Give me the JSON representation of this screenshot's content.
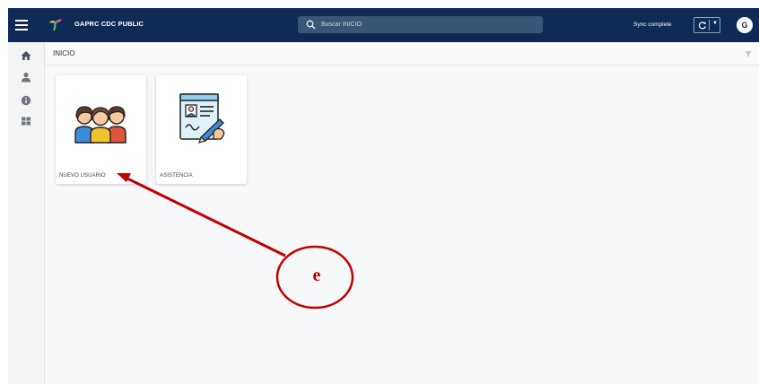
{
  "topbar": {
    "app_title": "GAPRC CDC PUBLIC",
    "search_placeholder": "Buscar INICIO",
    "sync_status": "Sync complete",
    "avatar_initial": "G"
  },
  "sidebar": {
    "items": [
      {
        "icon": "home-icon",
        "active": true
      },
      {
        "icon": "user-icon"
      },
      {
        "icon": "info-icon"
      },
      {
        "icon": "grid-icon"
      }
    ]
  },
  "main": {
    "page_title": "INICIO",
    "tiles": [
      {
        "label": "NUEVO USUARIO",
        "icon": "users-group-icon"
      },
      {
        "label": "ASISTENCIA",
        "icon": "attendance-form-icon"
      }
    ]
  },
  "annotation": {
    "label": "e",
    "color": "#c00000"
  },
  "colors": {
    "topbar": "#0d2b56",
    "search": "#3b5579",
    "accent_red": "#c00000"
  }
}
